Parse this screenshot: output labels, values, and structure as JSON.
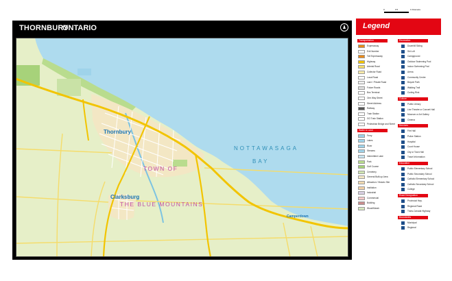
{
  "title": {
    "town": "THORNBURY",
    "province": "ONTARIO"
  },
  "map_labels": {
    "water": [
      "NOTTAWASAGA",
      "BAY"
    ],
    "towns": [
      "Thornbury",
      "Clarksburg",
      "Camperdown"
    ],
    "municipality": [
      "TOWN OF",
      "THE BLUE MOUNTAINS"
    ]
  },
  "legend": {
    "title": "Legend",
    "scale": {
      "labels": [
        "0",
        "0.5",
        "1 Kilometre"
      ]
    },
    "columns": [
      {
        "groups": [
          {
            "category": "Transportation",
            "items": [
              {
                "label": "Expressway",
                "color": "#e88a1a"
              },
              {
                "label": "Exit Number",
                "color": "#ffffff"
              },
              {
                "label": "Toll Expressway",
                "color": "#e88a1a"
              },
              {
                "label": "Highway",
                "color": "#f2c400"
              },
              {
                "label": "Arterial Road",
                "color": "#f5dc6a"
              },
              {
                "label": "Collector Road",
                "color": "#f7e9a8"
              },
              {
                "label": "Local Road",
                "color": "#ffffff"
              },
              {
                "label": "Lane / Private Road",
                "color": "#eeeeee"
              },
              {
                "label": "Future Roads",
                "color": "#dddddd"
              },
              {
                "label": "Bus Terminal",
                "color": "#ffffff"
              },
              {
                "label": "One Way Street",
                "color": "#ffffff"
              },
              {
                "label": "Street Address",
                "color": "#ffffff"
              },
              {
                "label": "Railway",
                "color": "#555555"
              },
              {
                "label": "Train Station",
                "color": "#ffffff"
              },
              {
                "label": "GO Train Station",
                "color": "#ffffff"
              },
              {
                "label": "Pedestrian Bridge and Street",
                "color": "#ffffff"
              }
            ]
          },
          {
            "category": "Water & Land",
            "items": [
              {
                "label": "Ferry",
                "color": "#9fd3ea"
              },
              {
                "label": "Lakes",
                "color": "#9fd3ea"
              },
              {
                "label": "River",
                "color": "#9fd3ea"
              },
              {
                "label": "Streams",
                "color": "#9fd3ea"
              },
              {
                "label": "Intermittent Lake",
                "color": "#c9e6f2"
              },
              {
                "label": "Park",
                "color": "#b9dc8e"
              },
              {
                "label": "Golf Course",
                "color": "#a7d27a"
              },
              {
                "label": "Cemetery",
                "color": "#cfe3b0"
              },
              {
                "label": "General Built-up Area",
                "color": "#f3e7c4"
              },
              {
                "label": "Attraction / Historic Site",
                "color": "#f0d9b0"
              },
              {
                "label": "Institution",
                "color": "#f2d0a6"
              },
              {
                "label": "Industrial",
                "color": "#d9cfe3"
              },
              {
                "label": "Commercial",
                "color": "#f4c9c9"
              },
              {
                "label": "Building",
                "color": "#c98d8d"
              },
              {
                "label": "Wood/Marsh",
                "color": "#d6e8bf"
              }
            ]
          }
        ]
      },
      {
        "groups": [
          {
            "category": "Recreation",
            "items": [
              {
                "label": "Downhill Skiing"
              },
              {
                "label": "Ski Loft"
              },
              {
                "label": "Campground"
              },
              {
                "label": "Outdoor Swimming Pool"
              },
              {
                "label": "Indoor Swimming Pool"
              },
              {
                "label": "Arena"
              },
              {
                "label": "Community Centre"
              },
              {
                "label": "Bicycle Path"
              },
              {
                "label": "Walking Trail"
              },
              {
                "label": "Curling Rink"
              }
            ]
          },
          {
            "category": "Culture",
            "items": [
              {
                "label": "Public Library"
              },
              {
                "label": "Live Theatre or Concert Hall"
              },
              {
                "label": "Museum or Art Gallery"
              },
              {
                "label": "Cinema"
              }
            ]
          },
          {
            "category": "Services",
            "items": [
              {
                "label": "Fire Hall"
              },
              {
                "label": "Police Station"
              },
              {
                "label": "Hospital"
              },
              {
                "label": "Court House"
              },
              {
                "label": "City or Town Hall"
              },
              {
                "label": "Travel Information"
              }
            ]
          },
          {
            "category": "Education",
            "items": [
              {
                "label": "Public Elementary School"
              },
              {
                "label": "Public Secondary School"
              },
              {
                "label": "Catholic Elementary School"
              },
              {
                "label": "Catholic Secondary School"
              },
              {
                "label": "College"
              }
            ]
          },
          {
            "category": "Road Designation",
            "items": [
              {
                "label": "Provincial Hwy."
              },
              {
                "label": "Regional Road"
              },
              {
                "label": "Trans-Canada Highway"
              }
            ]
          },
          {
            "category": "Boundaries",
            "items": [
              {
                "label": "Municipal"
              },
              {
                "label": "Regional"
              }
            ]
          }
        ]
      }
    ]
  },
  "colors": {
    "water": "#aedbee",
    "land": "#e6efc8",
    "highway": "#f2c400",
    "legend_accent": "#e30613"
  }
}
